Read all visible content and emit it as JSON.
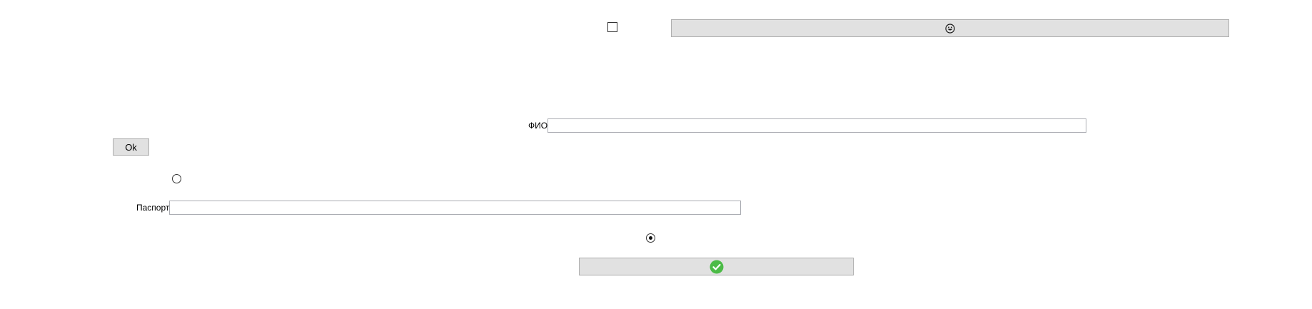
{
  "window": {
    "top_checkbox": {
      "checked": false
    },
    "top_button": {
      "icon": "smiley-face-icon"
    },
    "fio": {
      "label": "ФИО",
      "value": ""
    },
    "ok_button": {
      "label": "Ok"
    },
    "radio_a": {
      "checked": false
    },
    "passport": {
      "label": "Паспорт",
      "value": ""
    },
    "radio_b": {
      "checked": true
    },
    "confirm_button": {
      "icon": "green-check-icon",
      "icon_color": "#4CBB47"
    }
  }
}
